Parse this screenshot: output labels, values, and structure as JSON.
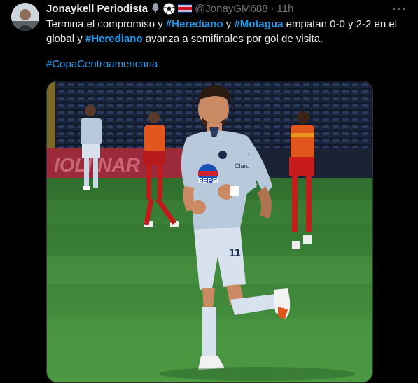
{
  "tweet": {
    "author_name": "Jonaykell Periodista",
    "handle": "@JonayGM688",
    "separator": "·",
    "time": "11h",
    "more_icon": "more-horizontal-icon",
    "text_parts": [
      "Termina el compromiso y ",
      "#Herediano",
      " y ",
      "#Motagua",
      " empatan 0-0 y 2-2 en el global y ",
      "#Herediano",
      " avanza a semifinales por gol de visita."
    ],
    "hashtag_line": "#CopaCentroamericana",
    "badges": [
      "microphone-emoji-icon",
      "soccer-ball-emoji-icon",
      "costa-rica-flag-icon"
    ]
  },
  "media": {
    "banner_text": "IOLI NAR",
    "player": {
      "shirt_sponsor": "PEPSI",
      "shirt_sponsor_2": "Claro",
      "shorts_number": "11"
    }
  },
  "colors": {
    "link": "#1d9bf0",
    "muted": "#71767b",
    "text": "#e7e9ea",
    "pitch": "#3f8a3a",
    "home_kit": "#b9c9dc",
    "away_kit": "#e0561c"
  }
}
